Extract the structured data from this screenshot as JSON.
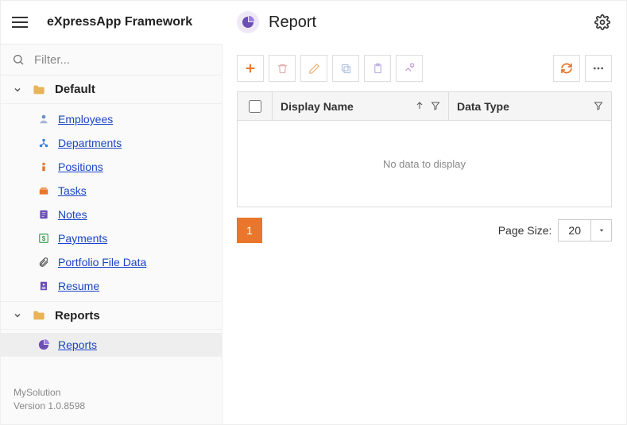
{
  "header": {
    "app_title": "eXpressApp Framework",
    "page_title": "Report"
  },
  "sidebar": {
    "filter_placeholder": "Filter...",
    "groups": [
      {
        "label": "Default",
        "items": [
          {
            "label": "Employees",
            "icon": "employees"
          },
          {
            "label": "Departments",
            "icon": "departments"
          },
          {
            "label": "Positions",
            "icon": "positions"
          },
          {
            "label": "Tasks",
            "icon": "tasks"
          },
          {
            "label": "Notes",
            "icon": "notes"
          },
          {
            "label": "Payments",
            "icon": "payments"
          },
          {
            "label": "Portfolio File Data",
            "icon": "attachment"
          },
          {
            "label": "Resume",
            "icon": "resume"
          }
        ]
      },
      {
        "label": "Reports",
        "items": [
          {
            "label": "Reports",
            "icon": "report",
            "selected": true
          }
        ]
      }
    ],
    "footer": {
      "solution": "MySolution",
      "version": "Version 1.0.8598"
    }
  },
  "toolbar": {
    "buttons": [
      "new",
      "delete",
      "edit",
      "copy",
      "paste",
      "paint"
    ]
  },
  "grid": {
    "columns": [
      {
        "key": "display_name",
        "label": "Display Name",
        "sortable": true,
        "filterable": true
      },
      {
        "key": "data_type",
        "label": "Data Type",
        "filterable": true
      }
    ],
    "rows": [],
    "empty_text": "No data to display"
  },
  "pager": {
    "current_page": "1",
    "page_size_label": "Page Size:",
    "page_size_value": "20"
  }
}
